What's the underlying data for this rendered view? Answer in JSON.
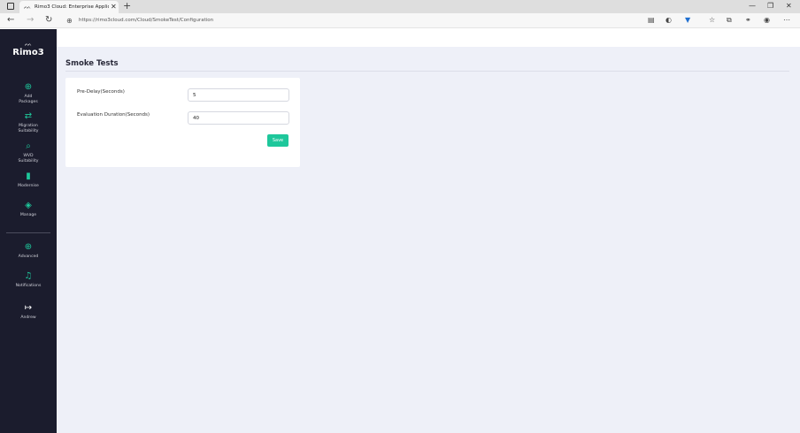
{
  "browser": {
    "tab_title": "Rimo3 Cloud: Enterprise Applica",
    "tab_close": "✕",
    "new_tab": "+",
    "url": "https://rimo3cloud.com/Cloud/SmokeTest/Configuration",
    "controls": {
      "minimize": "—",
      "restore": "❐",
      "close": "✕"
    },
    "nav": {
      "back": "←",
      "forward": "→",
      "refresh": "↻"
    }
  },
  "sidebar": {
    "logo_mark": "ᨓ",
    "logo_text": "Rimo3",
    "items": [
      {
        "icon": "⊕",
        "label_line1": "Add",
        "label_line2": "Packages"
      },
      {
        "icon": "⇄",
        "label_line1": "Migration",
        "label_line2": "Suitability"
      },
      {
        "icon": "⌕",
        "label_line1": "WVD",
        "label_line2": "Suitability"
      },
      {
        "icon": "▮",
        "label_line1": "Modernise",
        "label_line2": ""
      },
      {
        "icon": "◈",
        "label_line1": "Manage",
        "label_line2": ""
      },
      {
        "icon": "⊕",
        "label_line1": "Advanced",
        "label_line2": ""
      },
      {
        "icon": "♫",
        "label_line1": "Notifications",
        "label_line2": ""
      },
      {
        "icon": "↦",
        "label_line1": "Andrew",
        "label_line2": ""
      }
    ]
  },
  "main": {
    "title": "Smoke Tests",
    "form": {
      "pre_delay_label": "Pre-Delay(Seconds)",
      "pre_delay_value": "5",
      "evaluation_duration_label": "Evaluation Duration(Seconds)",
      "evaluation_duration_value": "40",
      "save_label": "Save"
    }
  },
  "colors": {
    "sidebar_bg": "#1b1c2d",
    "accent": "#1ec79b",
    "main_bg": "#eef0f8"
  }
}
